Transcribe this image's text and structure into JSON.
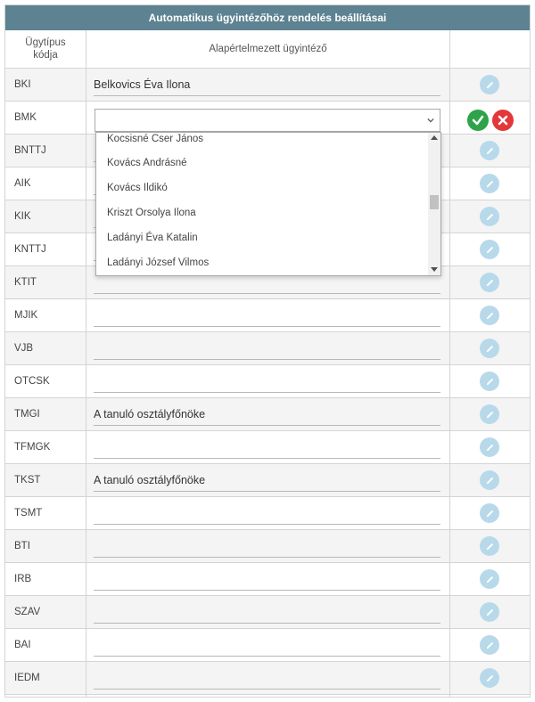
{
  "title": "Automatikus ügyintézőhöz rendelés beállításai",
  "headers": {
    "code_line1": "Ügytípus",
    "code_line2": "kódja",
    "assignee": "Alapértelmezett ügyintéző"
  },
  "rows": [
    {
      "code": "BKI",
      "value": "Belkovics Éva Ilona"
    },
    {
      "code": "BMK",
      "value": ""
    },
    {
      "code": "BNTTJ",
      "value": ""
    },
    {
      "code": "AIK",
      "value": ""
    },
    {
      "code": "KIK",
      "value": ""
    },
    {
      "code": "KNTTJ",
      "value": ""
    },
    {
      "code": "KTIT",
      "value": ""
    },
    {
      "code": "MJIK",
      "value": ""
    },
    {
      "code": "VJB",
      "value": ""
    },
    {
      "code": "OTCSK",
      "value": ""
    },
    {
      "code": "TMGI",
      "value": "A tanuló osztályfőnöke"
    },
    {
      "code": "TFMGK",
      "value": ""
    },
    {
      "code": "TKST",
      "value": "A tanuló osztályfőnöke"
    },
    {
      "code": "TSMT",
      "value": ""
    },
    {
      "code": "BTI",
      "value": ""
    },
    {
      "code": "IRB",
      "value": ""
    },
    {
      "code": "SZAV",
      "value": ""
    },
    {
      "code": "BAI",
      "value": ""
    },
    {
      "code": "IEDM",
      "value": ""
    }
  ],
  "dropdown": {
    "options": [
      "Kocsisné Cser János",
      "Kovács Andrásné",
      "Kovács Ildikó",
      "Kriszt Orsolya Ilona",
      "Ladányi Éva Katalin",
      "Ladányi József Vilmos"
    ],
    "scroll_position": 0.45
  },
  "icons": {
    "edit": "pencil-icon",
    "confirm": "check-icon",
    "cancel": "close-icon",
    "select_arrow": "chevron-down-icon"
  },
  "colors": {
    "title_bar": "#5d8291",
    "edit_button": "#b8d9ea",
    "confirm_button": "#2ea34a",
    "cancel_button": "#e2373b",
    "alt_row": "#f4f4f4"
  }
}
